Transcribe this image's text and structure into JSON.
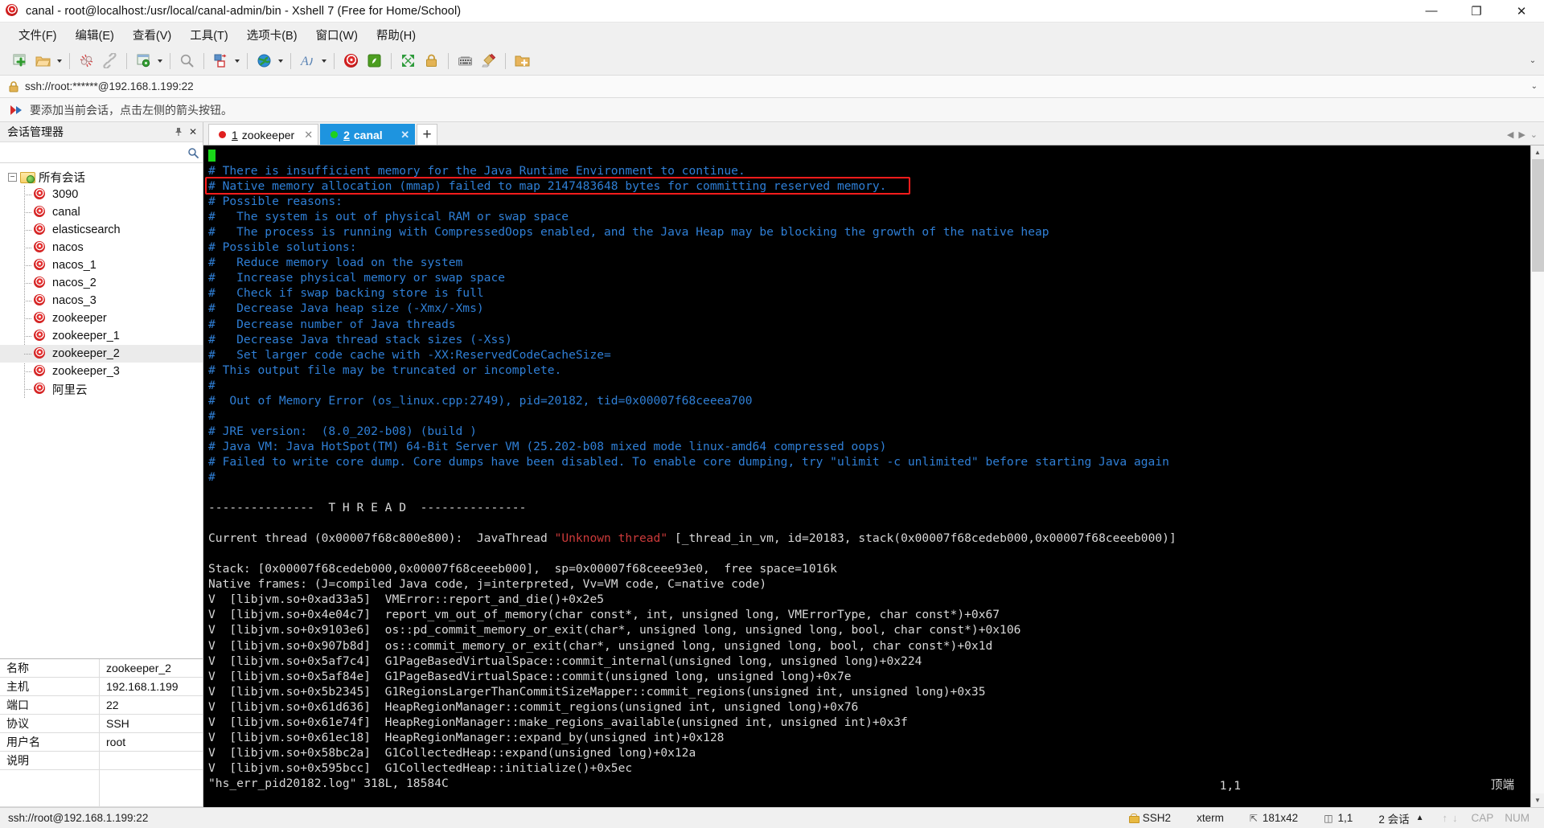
{
  "window": {
    "title": "canal - root@localhost:/usr/local/canal-admin/bin - Xshell 7 (Free for Home/School)",
    "minimize": "—",
    "maximize": "❐",
    "close": "✕"
  },
  "menubar": {
    "items": [
      {
        "label": "文件(F)",
        "name": "menu-file"
      },
      {
        "label": "编辑(E)",
        "name": "menu-edit"
      },
      {
        "label": "查看(V)",
        "name": "menu-view"
      },
      {
        "label": "工具(T)",
        "name": "menu-tools"
      },
      {
        "label": "选项卡(B)",
        "name": "menu-tab"
      },
      {
        "label": "窗口(W)",
        "name": "menu-window"
      },
      {
        "label": "帮助(H)",
        "name": "menu-help"
      }
    ]
  },
  "toolbar": {
    "collapse_glyph": "⌄",
    "buttons": [
      "new-session-icon",
      "open-folder-icon",
      "disconnect-icon",
      "reconnect-icon",
      "session-properties-icon",
      "find-icon",
      "transfer-file-icon",
      "web-browser-icon",
      "font-icon",
      "xshell-icon",
      "xftp-icon",
      "fullscreen-icon",
      "lock-icon",
      "keyboard-icon",
      "highlight-icon",
      "add-folder-icon"
    ]
  },
  "addressbar": {
    "value": "ssh://root:******@192.168.1.199:22",
    "lock_icon": "lock-icon",
    "caret": "⌄"
  },
  "notice": {
    "text": "要添加当前会话，点击左侧的箭头按钮。",
    "icon": "red-arrow-icon"
  },
  "sidebar": {
    "panel_title": "会话管理器",
    "pin_glyph": "📌",
    "close_glyph": "✕",
    "search_placeholder": "",
    "search_value": "",
    "search_icon": "search-icon",
    "root": {
      "label": "所有会话",
      "expander": "−"
    },
    "items": [
      {
        "label": "3090",
        "selected": false
      },
      {
        "label": "canal",
        "selected": false
      },
      {
        "label": "elasticsearch",
        "selected": false
      },
      {
        "label": "nacos",
        "selected": false
      },
      {
        "label": "nacos_1",
        "selected": false
      },
      {
        "label": "nacos_2",
        "selected": false
      },
      {
        "label": "nacos_3",
        "selected": false
      },
      {
        "label": "zookeeper",
        "selected": false
      },
      {
        "label": "zookeeper_1",
        "selected": false
      },
      {
        "label": "zookeeper_2",
        "selected": true
      },
      {
        "label": "zookeeper_3",
        "selected": false
      },
      {
        "label": "阿里云",
        "selected": false
      }
    ]
  },
  "properties": {
    "rows": [
      {
        "key": "名称",
        "value": "zookeeper_2"
      },
      {
        "key": "主机",
        "value": "192.168.1.199"
      },
      {
        "key": "端口",
        "value": "22"
      },
      {
        "key": "协议",
        "value": "SSH"
      },
      {
        "key": "用户名",
        "value": "root"
      },
      {
        "key": "说明",
        "value": ""
      }
    ]
  },
  "tabs": {
    "items": [
      {
        "num": "1",
        "label": "zookeeper",
        "active": false,
        "dot_color": "#e02020",
        "close": "✕"
      },
      {
        "num": "2",
        "label": "canal",
        "active": true,
        "dot_color": "#1ed11e",
        "close": "✕"
      }
    ],
    "add_label": "+",
    "nav_left": "◀",
    "nav_right": "▶",
    "nav_menu": "⌄"
  },
  "terminal": {
    "cursor_row": "█",
    "highlight_color": "#ff1c1c",
    "cursor_pos": "1,1",
    "mode_label": "顶端",
    "lines": [
      {
        "t": "# There is insufficient memory for the Java Runtime Environment to continue.",
        "c": "blue"
      },
      {
        "t": "# Native memory allocation (mmap) failed to map 2147483648 bytes for committing reserved memory.",
        "c": "blue",
        "highlight": true
      },
      {
        "t": "# Possible reasons:",
        "c": "blue"
      },
      {
        "t": "#   The system is out of physical RAM or swap space",
        "c": "blue"
      },
      {
        "t": "#   The process is running with CompressedOops enabled, and the Java Heap may be blocking the growth of the native heap",
        "c": "blue"
      },
      {
        "t": "# Possible solutions:",
        "c": "blue"
      },
      {
        "t": "#   Reduce memory load on the system",
        "c": "blue"
      },
      {
        "t": "#   Increase physical memory or swap space",
        "c": "blue"
      },
      {
        "t": "#   Check if swap backing store is full",
        "c": "blue"
      },
      {
        "t": "#   Decrease Java heap size (-Xmx/-Xms)",
        "c": "blue"
      },
      {
        "t": "#   Decrease number of Java threads",
        "c": "blue"
      },
      {
        "t": "#   Decrease Java thread stack sizes (-Xss)",
        "c": "blue"
      },
      {
        "t": "#   Set larger code cache with -XX:ReservedCodeCacheSize=",
        "c": "blue"
      },
      {
        "t": "# This output file may be truncated or incomplete.",
        "c": "blue"
      },
      {
        "t": "#",
        "c": "blue"
      },
      {
        "t": "#  Out of Memory Error (os_linux.cpp:2749), pid=20182, tid=0x00007f68ceeea700",
        "c": "blue"
      },
      {
        "t": "#",
        "c": "blue"
      },
      {
        "t": "# JRE version:  (8.0_202-b08) (build )",
        "c": "blue"
      },
      {
        "t": "# Java VM: Java HotSpot(TM) 64-Bit Server VM (25.202-b08 mixed mode linux-amd64 compressed oops)",
        "c": "blue"
      },
      {
        "t": "# Failed to write core dump. Core dumps have been disabled. To enable core dumping, try \"ulimit -c unlimited\" before starting Java again",
        "c": "blue"
      },
      {
        "t": "#",
        "c": "blue"
      },
      {
        "t": "",
        "c": "white"
      },
      {
        "t": "---------------  T H R E A D  ---------------",
        "c": "white"
      },
      {
        "t": "",
        "c": "white"
      },
      {
        "t": "Current thread (0x00007f68c800e800):  JavaThread §r\"Unknown thread\"§w [_thread_in_vm, id=20183, stack(0x00007f68cedeb000,0x00007f68ceeeb000)]",
        "c": "white",
        "markup": true
      },
      {
        "t": "",
        "c": "white"
      },
      {
        "t": "Stack: [0x00007f68cedeb000,0x00007f68ceeeb000],  sp=0x00007f68ceee93e0,  free space=1016k",
        "c": "white"
      },
      {
        "t": "Native frames: (J=compiled Java code, j=interpreted, Vv=VM code, C=native code)",
        "c": "white"
      },
      {
        "t": "V  [libjvm.so+0xad33a5]  VMError::report_and_die()+0x2e5",
        "c": "white"
      },
      {
        "t": "V  [libjvm.so+0x4e04c7]  report_vm_out_of_memory(char const*, int, unsigned long, VMErrorType, char const*)+0x67",
        "c": "white"
      },
      {
        "t": "V  [libjvm.so+0x9103e6]  os::pd_commit_memory_or_exit(char*, unsigned long, unsigned long, bool, char const*)+0x106",
        "c": "white"
      },
      {
        "t": "V  [libjvm.so+0x907b8d]  os::commit_memory_or_exit(char*, unsigned long, unsigned long, bool, char const*)+0x1d",
        "c": "white"
      },
      {
        "t": "V  [libjvm.so+0x5af7c4]  G1PageBasedVirtualSpace::commit_internal(unsigned long, unsigned long)+0x224",
        "c": "white"
      },
      {
        "t": "V  [libjvm.so+0x5af84e]  G1PageBasedVirtualSpace::commit(unsigned long, unsigned long)+0x7e",
        "c": "white"
      },
      {
        "t": "V  [libjvm.so+0x5b2345]  G1RegionsLargerThanCommitSizeMapper::commit_regions(unsigned int, unsigned long)+0x35",
        "c": "white"
      },
      {
        "t": "V  [libjvm.so+0x61d636]  HeapRegionManager::commit_regions(unsigned int, unsigned long)+0x76",
        "c": "white"
      },
      {
        "t": "V  [libjvm.so+0x61e74f]  HeapRegionManager::make_regions_available(unsigned int, unsigned int)+0x3f",
        "c": "white"
      },
      {
        "t": "V  [libjvm.so+0x61ec18]  HeapRegionManager::expand_by(unsigned int)+0x128",
        "c": "white"
      },
      {
        "t": "V  [libjvm.so+0x58bc2a]  G1CollectedHeap::expand(unsigned long)+0x12a",
        "c": "white"
      },
      {
        "t": "V  [libjvm.so+0x595bcc]  G1CollectedHeap::initialize()+0x5ec",
        "c": "white"
      },
      {
        "t": "\"hs_err_pid20182.log\" 318L, 18584C",
        "c": "white"
      }
    ]
  },
  "statusbar": {
    "connection": "ssh://root@192.168.1.199:22",
    "security": "SSH2",
    "terminal_type": "xterm",
    "size": "181x42",
    "size_icon": "resize-icon",
    "cursor": "1,1",
    "cursor_icon": "cursor-icon",
    "sessions": "2 会话",
    "sessions_caret": "▲",
    "up_arrow": "↑",
    "down_arrow": "↓",
    "cap": "CAP",
    "num": "NUM"
  }
}
